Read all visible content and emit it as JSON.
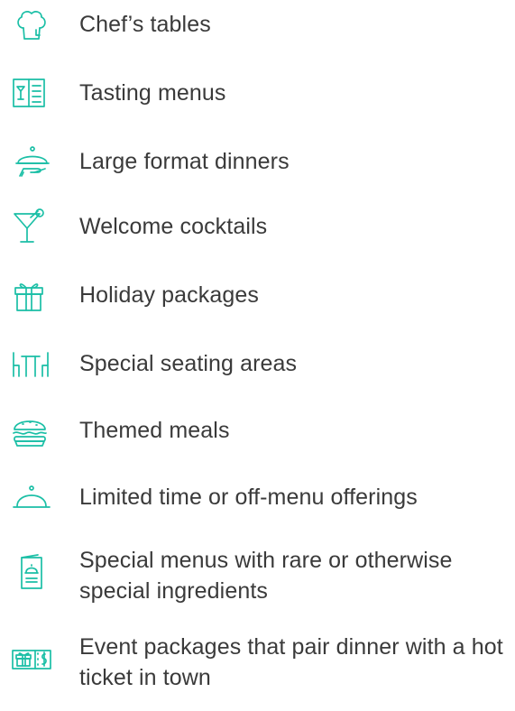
{
  "list": {
    "items": [
      {
        "label": "Chef’s tables",
        "icon": "chef-hat-icon"
      },
      {
        "label": "Tasting menus",
        "icon": "menu-book-icon"
      },
      {
        "label": "Large format dinners",
        "icon": "serving-cloche-hand-icon"
      },
      {
        "label": "Welcome cocktails",
        "icon": "cocktail-glass-icon"
      },
      {
        "label": "Holiday packages",
        "icon": "gift-box-icon"
      },
      {
        "label": "Special seating areas",
        "icon": "table-chairs-icon"
      },
      {
        "label": "Themed meals",
        "icon": "burger-icon"
      },
      {
        "label": "Limited time or off-menu offerings",
        "icon": "cloche-icon"
      },
      {
        "label": "Special menus with rare or otherwise special ingredients",
        "icon": "menu-card-icon"
      },
      {
        "label": "Event packages that pair dinner with a hot ticket in town",
        "icon": "gift-ticket-icon"
      }
    ]
  },
  "colors": {
    "accent": "#1bbfa6",
    "text": "#3a3a3a",
    "background": "#ffffff"
  }
}
